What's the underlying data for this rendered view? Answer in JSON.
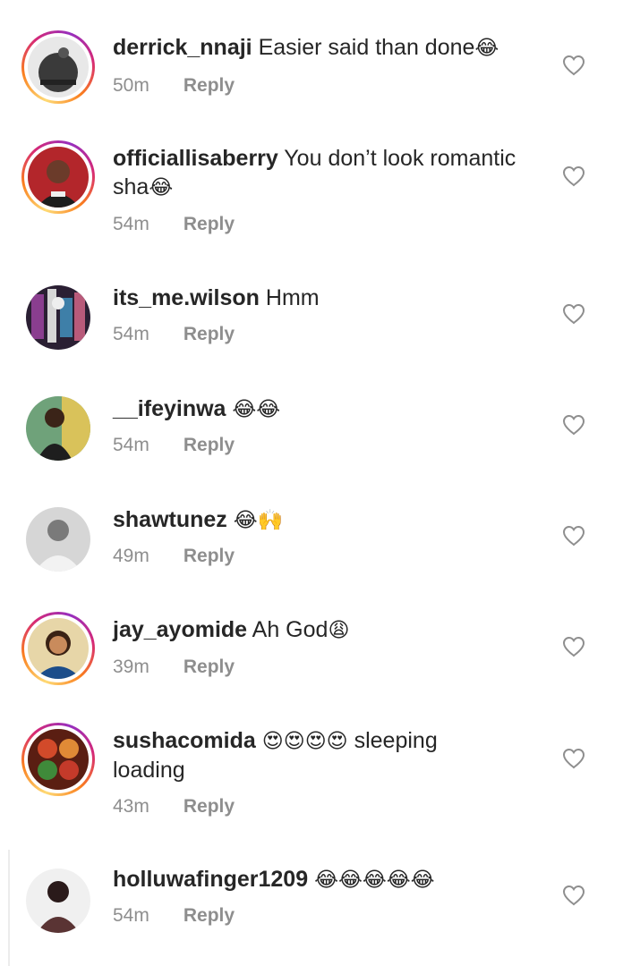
{
  "comments": [
    {
      "username": "derrick_nnaji",
      "text": " Easier said than done",
      "emoji": "😂",
      "time": "50m",
      "reply": "Reply",
      "ring": true,
      "avatar_color": "#3a3a3a"
    },
    {
      "username": "officiallisaberry",
      "text": " You don’t look romantic sha",
      "emoji": "😂",
      "time": "54m",
      "reply": "Reply",
      "ring": true,
      "avatar_color": "#b3262b"
    },
    {
      "username": "its_me.wilson",
      "text": " Hmm",
      "emoji": "",
      "time": "54m",
      "reply": "Reply",
      "ring": false,
      "avatar_color": "#5a3c72"
    },
    {
      "username": "__ifeyinwa",
      "text": " ",
      "emoji": "😂😂",
      "time": "54m",
      "reply": "Reply",
      "ring": false,
      "avatar_color": "#4d7f5a"
    },
    {
      "username": "shawtunez",
      "text": " ",
      "emoji": "😂🙌",
      "time": "49m",
      "reply": "Reply",
      "ring": false,
      "avatar_color": "#c9c9c9"
    },
    {
      "username": "jay_ayomide",
      "text": " Ah God",
      "emoji": "😩",
      "time": "39m",
      "reply": "Reply",
      "ring": true,
      "avatar_color": "#d2a86c"
    },
    {
      "username": "sushacomida",
      "text": " ",
      "emoji": "😍😍😍😍",
      "text2": " sleeping loading",
      "time": "43m",
      "reply": "Reply",
      "ring": true,
      "avatar_color": "#7a2f22"
    },
    {
      "username": "holluwafinger1209",
      "text": " ",
      "emoji": "😂😂😂😂😂",
      "time": "54m",
      "reply": "Reply",
      "ring": false,
      "avatar_color": "#5a3434"
    }
  ],
  "icons": {
    "like": "heart-outline-icon"
  },
  "colors": {
    "meta": "#8e8e8e",
    "text": "#262626"
  }
}
